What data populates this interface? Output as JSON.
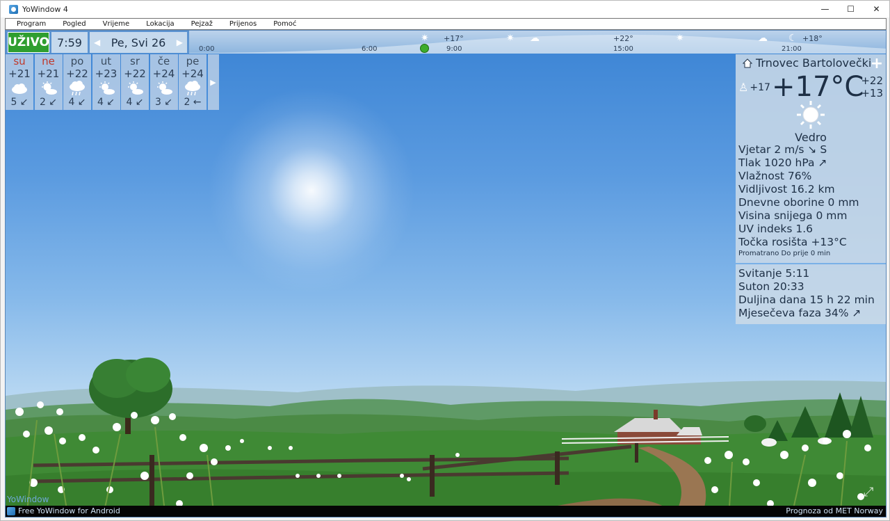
{
  "window": {
    "title": "YoWindow 4",
    "minimize": "—",
    "maximize": "☐",
    "close": "✕"
  },
  "menu": [
    "Program",
    "Pogled",
    "Vrijeme",
    "Lokacija",
    "Pejzaž",
    "Prijenos",
    "Pomoć"
  ],
  "timeline": {
    "live_label": "UŽIVO",
    "time": "7:59",
    "date": "Pe, Svi 26",
    "prev": "◀",
    "next": "▶",
    "hours": [
      "0:00",
      "6:00",
      "9:00",
      "15:00",
      "21:00"
    ],
    "temps": [
      "+17°",
      "+22°",
      "+18°"
    ]
  },
  "forecast": {
    "days": [
      {
        "name": "su",
        "temp": "+21",
        "icon": "cloud-icon",
        "wind": "5 ↙",
        "weekend": true
      },
      {
        "name": "ne",
        "temp": "+21",
        "icon": "sun-cloud-icon",
        "wind": "2 ↙",
        "weekend": true
      },
      {
        "name": "po",
        "temp": "+22",
        "icon": "rain-cloud-icon",
        "wind": "4 ↙",
        "weekend": false
      },
      {
        "name": "ut",
        "temp": "+23",
        "icon": "sun-cloud-icon",
        "wind": "4 ↙",
        "weekend": false
      },
      {
        "name": "sr",
        "temp": "+22",
        "icon": "sun-cloud-icon",
        "wind": "4 ↙",
        "weekend": false
      },
      {
        "name": "če",
        "temp": "+24",
        "icon": "sun-cloud-icon",
        "wind": "3 ↙",
        "weekend": false
      },
      {
        "name": "pe",
        "temp": "+24",
        "icon": "rain-cloud-icon",
        "wind": "2 ←",
        "weekend": false
      }
    ],
    "more": "▶"
  },
  "current": {
    "location": "Trnovec Bartolovečki",
    "feels_like": "+17",
    "temperature": "+17°C",
    "high": "+22",
    "low": "+13",
    "condition": "Vedro",
    "details": [
      "Vjetar  2 m/s ↘ S",
      "Tlak  1020 hPa ↗",
      "Vlažnost  76%",
      "Vidljivost  16.2 km",
      "Dnevne oborine  0 mm",
      "Visina snijega  0 mm",
      "UV indeks  1.6",
      "Točka rosišta  +13°C"
    ],
    "observed": "Promatrano Do prije 0 min"
  },
  "astro": [
    "Svitanje  5:11",
    "Suton  20:33",
    "Duljina dana  15 h 22 min",
    "Mjesečeva faza  34% ↗"
  ],
  "footer": {
    "brand": "YoWindow",
    "android": "Free YoWindow for Android",
    "credit": "Prognoza od MET Norway"
  },
  "colors": {
    "live": "#2f9e2f",
    "weekend": "#c0392b",
    "text": "#1d2f45"
  }
}
